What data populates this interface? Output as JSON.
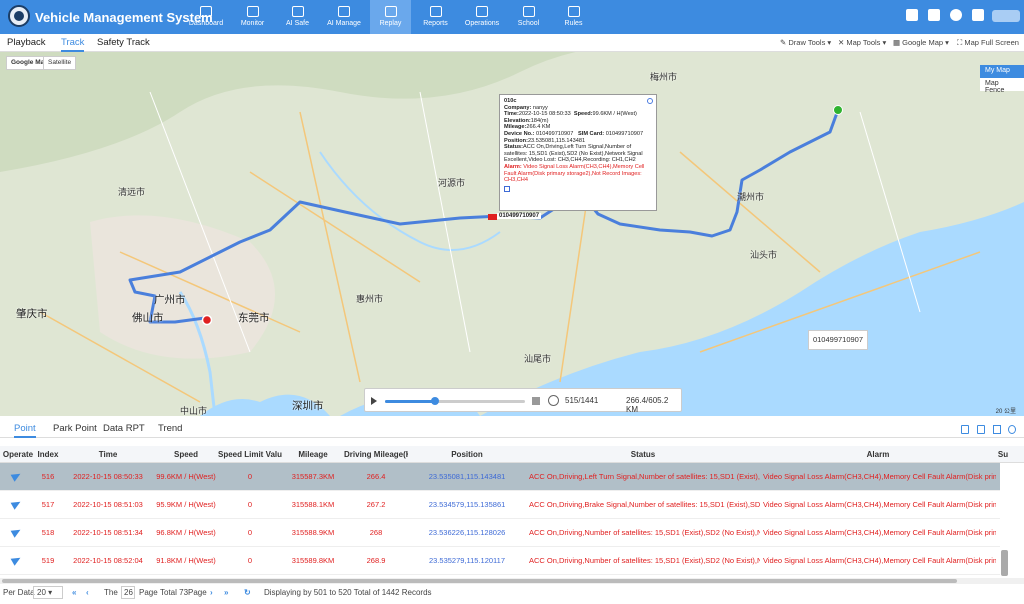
{
  "app": {
    "title": "Vehicle Management System"
  },
  "nav": [
    {
      "label": "Dashboard",
      "icon": "dashboard-icon"
    },
    {
      "label": "Monitor",
      "icon": "location-pin-icon"
    },
    {
      "label": "AI Safe",
      "icon": "shield-icon"
    },
    {
      "label": "AI Manage",
      "icon": "shield-manage-icon"
    },
    {
      "label": "Replay",
      "icon": "replay-icon",
      "active": true
    },
    {
      "label": "Reports",
      "icon": "bar-chart-icon"
    },
    {
      "label": "Operations",
      "icon": "operations-icon"
    },
    {
      "label": "School",
      "icon": "school-icon"
    },
    {
      "label": "Rules",
      "icon": "rules-icon"
    }
  ],
  "subtabs": [
    "Playback",
    "Track",
    "Safety Track"
  ],
  "tools": [
    "Draw Tools",
    "Map Tools",
    "Google Map",
    "Map Full Screen"
  ],
  "map": {
    "types": [
      "Google Map",
      "Satellite"
    ],
    "layers": [
      "My Map",
      "Map Fence"
    ],
    "cities": [
      {
        "name": "清远市"
      },
      {
        "name": "肇庆市"
      },
      {
        "name": "广州市"
      },
      {
        "name": "佛山市"
      },
      {
        "name": "东莞市"
      },
      {
        "name": "惠州市"
      },
      {
        "name": "深圳市"
      },
      {
        "name": "中山市"
      },
      {
        "name": "河源市"
      },
      {
        "name": "梅州市"
      },
      {
        "name": "潮州市"
      },
      {
        "name": "汕头市"
      },
      {
        "name": "汕尾市"
      }
    ],
    "popup": {
      "header": "010c",
      "company_label": "Company:",
      "company": "nanyy",
      "time_label": "Time:",
      "time": "2022-10-15 08:50:33",
      "speed_label": "Speed:",
      "speed": "99.6KM / H(West)",
      "elevation_label": "Elevation:",
      "elevation": "184(m)",
      "mileage_label": "Mileage:",
      "mileage": "266.4 KM",
      "device_label": "Device No.:",
      "device": "010499710907",
      "sim_label": "SIM Card:",
      "sim": "010499710907",
      "position_label": "Position:",
      "position": "23.535081,115.143481",
      "status_label": "Status:",
      "status": "ACC On,Driving,Left Turn Signal,Number of satellites: 15,SD1 (Exist),SD2 (No Exist),Network Signal Excellent,Video Lost: CH3,CH4,Recording: CH1,CH2",
      "alarm_label": "Alarm:",
      "alarm": "Video Signal Loss Alarm(CH3,CH4),Memory Cell Fault Alarm(Disk primary storage2),Not Record Images: CH3,CH4"
    },
    "car_label": "010499710907",
    "plate_box": "010499710907",
    "scale": "20 公里"
  },
  "player": {
    "count": "515/1441",
    "distance": "266.4/605.2 KM",
    "progress": 0.357
  },
  "bottom_tabs": [
    "Point",
    "Park Point",
    "Data RPT",
    "Trend"
  ],
  "table": {
    "headers": [
      "Operate",
      "Index",
      "Time",
      "Speed",
      "Speed Limit Value",
      "Mileage",
      "Driving Mileage(KM)",
      "Position",
      "Status",
      "Alarm",
      "Su"
    ],
    "rows": [
      {
        "index": "516",
        "time": "2022-10-15 08:50:33",
        "speed": "99.6KM / H(West)",
        "limit": "0",
        "mileage": "315587.3KM",
        "driving": "266.4",
        "position": "23.535081,115.143481",
        "status": "ACC On,Driving,Left Turn Signal,Number of satellites: 15,SD1 (Exist),SD2",
        "alarm": "Video Signal Loss Alarm(CH3,CH4),Memory Cell Fault Alarm(Disk prima"
      },
      {
        "index": "517",
        "time": "2022-10-15 08:51:03",
        "speed": "95.9KM / H(West)",
        "limit": "0",
        "mileage": "315588.1KM",
        "driving": "267.2",
        "position": "23.534579,115.135861",
        "status": "ACC On,Driving,Brake Signal,Number of satellites: 15,SD1 (Exist),SD2 (No",
        "alarm": "Video Signal Loss Alarm(CH3,CH4),Memory Cell Fault Alarm(Disk prima"
      },
      {
        "index": "518",
        "time": "2022-10-15 08:51:34",
        "speed": "96.8KM / H(West)",
        "limit": "0",
        "mileage": "315588.9KM",
        "driving": "268",
        "position": "23.536226,115.128026",
        "status": "ACC On,Driving,Number of satellites: 15,SD1 (Exist),SD2 (No Exist),Net",
        "alarm": "Video Signal Loss Alarm(CH3,CH4),Memory Cell Fault Alarm(Disk prima"
      },
      {
        "index": "519",
        "time": "2022-10-15 08:52:04",
        "speed": "91.8KM / H(West)",
        "limit": "0",
        "mileage": "315589.8KM",
        "driving": "268.9",
        "position": "23.535279,115.120117",
        "status": "ACC On,Driving,Number of satellites: 15,SD1 (Exist),SD2 (No Exist),Net",
        "alarm": "Video Signal Loss Alarm(CH3,CH4),Memory Cell Fault Alarm(Disk prima"
      }
    ]
  },
  "pager": {
    "per_label": "Per Data",
    "per_value": "20",
    "the": "The",
    "page": "26",
    "page_label": "Page",
    "total": "Total 73Page",
    "display": "Displaying by 501 to 520 Total of 1442 Records"
  }
}
